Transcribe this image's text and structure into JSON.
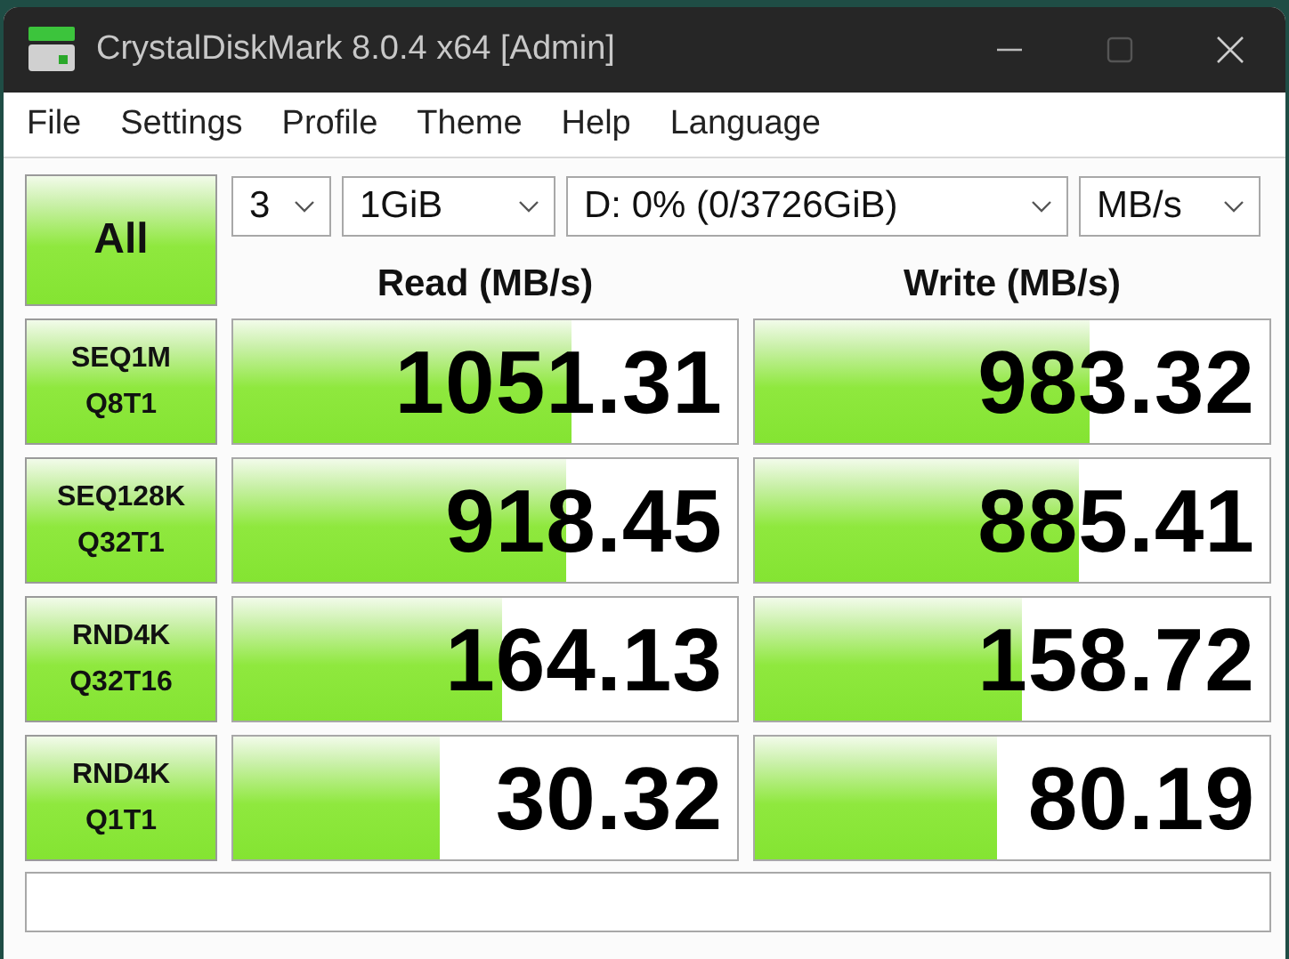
{
  "window": {
    "title": "CrystalDiskMark 8.0.4 x64 [Admin]"
  },
  "menu": [
    "File",
    "Settings",
    "Profile",
    "Theme",
    "Help",
    "Language"
  ],
  "all_button": "All",
  "selectors": [
    {
      "value": "3"
    },
    {
      "value": "1GiB"
    },
    {
      "value": "D: 0% (0/3726GiB)"
    },
    {
      "value": "MB/s"
    }
  ],
  "columns": [
    "Read (MB/s)",
    "Write (MB/s)"
  ],
  "tests": [
    {
      "lines": [
        "SEQ1M",
        "Q8T1"
      ],
      "read": {
        "value": "1051.31",
        "level": 0.67
      },
      "write": {
        "value": "983.32",
        "level": 0.65
      }
    },
    {
      "lines": [
        "SEQ128K",
        "Q32T1"
      ],
      "read": {
        "value": "918.45",
        "level": 0.66
      },
      "write": {
        "value": "885.41",
        "level": 0.63
      }
    },
    {
      "lines": [
        "RND4K",
        "Q32T16"
      ],
      "read": {
        "value": "164.13",
        "level": 0.535
      },
      "write": {
        "value": "158.72",
        "level": 0.52
      }
    },
    {
      "lines": [
        "RND4K",
        "Q1T1"
      ],
      "read": {
        "value": "30.32",
        "level": 0.41
      },
      "write": {
        "value": "80.19",
        "level": 0.47
      }
    }
  ]
}
